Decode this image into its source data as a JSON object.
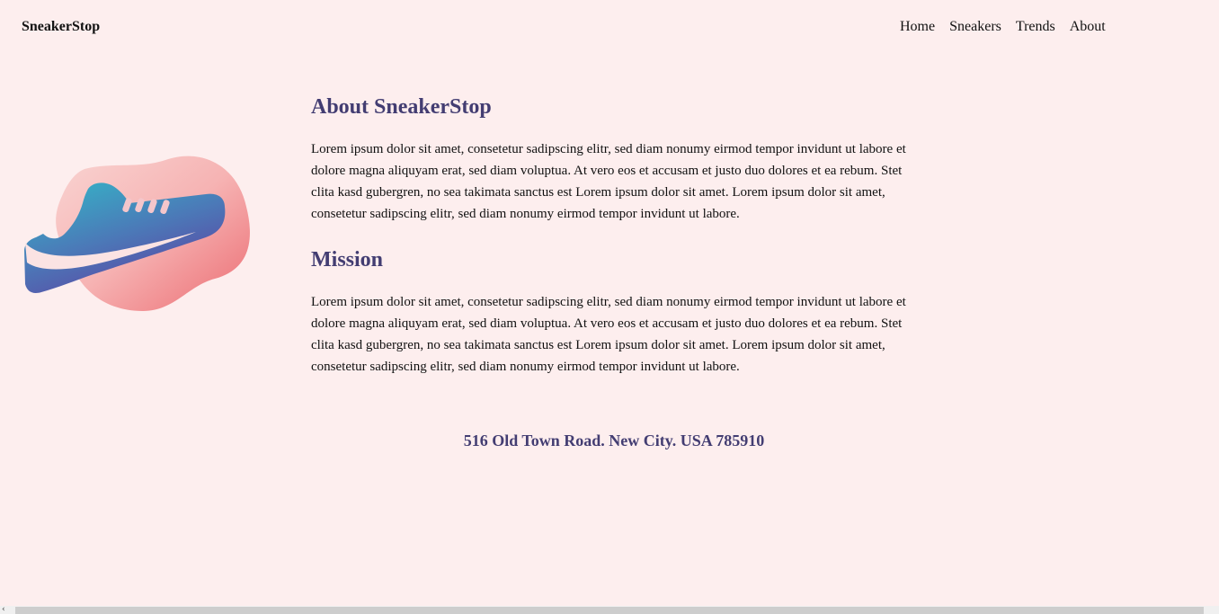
{
  "brand": {
    "name": "SneakerStop"
  },
  "nav": {
    "items": [
      {
        "label": "Home"
      },
      {
        "label": "Sneakers"
      },
      {
        "label": "Trends"
      },
      {
        "label": "About"
      }
    ]
  },
  "hero": {
    "icon": "sneaker-illustration"
  },
  "about": {
    "title": "About SneakerStop",
    "body": "Lorem ipsum dolor sit amet, consetetur sadipscing elitr, sed diam nonumy eirmod tempor invidunt ut labore et dolore magna aliquyam erat, sed diam voluptua. At vero eos et accusam et justo duo dolores et ea rebum. Stet clita kasd gubergren, no sea takimata sanctus est Lorem ipsum dolor sit amet. Lorem ipsum dolor sit amet, consetetur sadipscing elitr, sed diam nonumy eirmod tempor invidunt ut labore."
  },
  "mission": {
    "title": "Mission",
    "body": "Lorem ipsum dolor sit amet, consetetur sadipscing elitr, sed diam nonumy eirmod tempor invidunt ut labore et dolore magna aliquyam erat, sed diam voluptua. At vero eos et accusam et justo duo dolores et ea rebum. Stet clita kasd gubergren, no sea takimata sanctus est Lorem ipsum dolor sit amet. Lorem ipsum dolor sit amet, consetetur sadipscing elitr, sed diam nonumy eirmod tempor invidunt ut labore."
  },
  "footer": {
    "address": "516 Old Town Road. New City. USA 785910"
  },
  "colors": {
    "background": "#fdeeee",
    "accent": "#433d72",
    "blob_light": "#f9c9c9",
    "blob_dark": "#ee6e74",
    "shoe_teal": "#34b3c6",
    "shoe_purple": "#5b4aa6"
  }
}
